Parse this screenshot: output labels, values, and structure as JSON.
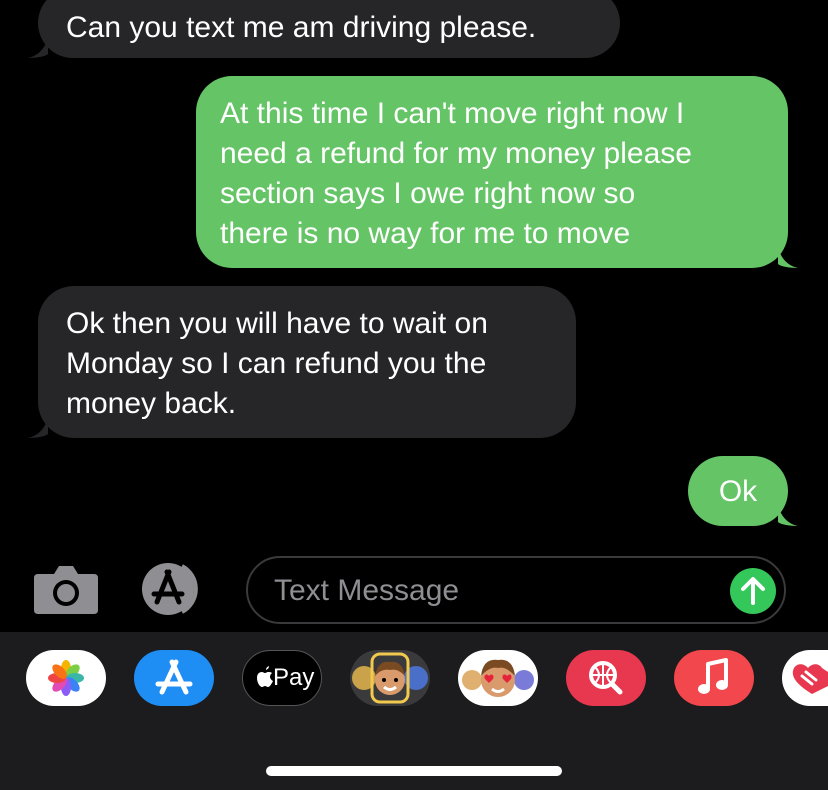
{
  "messages": [
    {
      "direction": "incoming",
      "text": "Can you text me am driving please."
    },
    {
      "direction": "outgoing",
      "text": "At this time I can't move right now I\nneed a refund for my money please\nsection says I owe right now so\nthere is no way for me to move"
    },
    {
      "direction": "incoming",
      "text": "Ok then you will have to wait on\nMonday so I can refund you the\nmoney back."
    },
    {
      "direction": "outgoing",
      "text": "Ok"
    }
  ],
  "composer": {
    "placeholder": "Text Message",
    "camera_icon": "camera-icon",
    "apps_icon": "app-store-icon",
    "send_icon": "arrow-up-icon"
  },
  "app_drawer": {
    "apps": [
      {
        "name": "Photos",
        "icon": "photos-icon"
      },
      {
        "name": "App Store",
        "icon": "app-store-icon"
      },
      {
        "name": "Apple Pay",
        "icon": "apple-pay-icon",
        "label": "Pay"
      },
      {
        "name": "Memoji",
        "icon": "memoji-icon"
      },
      {
        "name": "Memoji Stickers",
        "icon": "memoji-stickers-icon"
      },
      {
        "name": "Images",
        "icon": "images-search-icon"
      },
      {
        "name": "Music",
        "icon": "music-icon"
      },
      {
        "name": "Digital Touch",
        "icon": "digital-touch-icon"
      }
    ]
  },
  "colors": {
    "background": "#000000",
    "incoming_bubble": "#262628",
    "outgoing_bubble": "#65c466",
    "send_button": "#34c759",
    "drawer": "#1c1c1e"
  }
}
